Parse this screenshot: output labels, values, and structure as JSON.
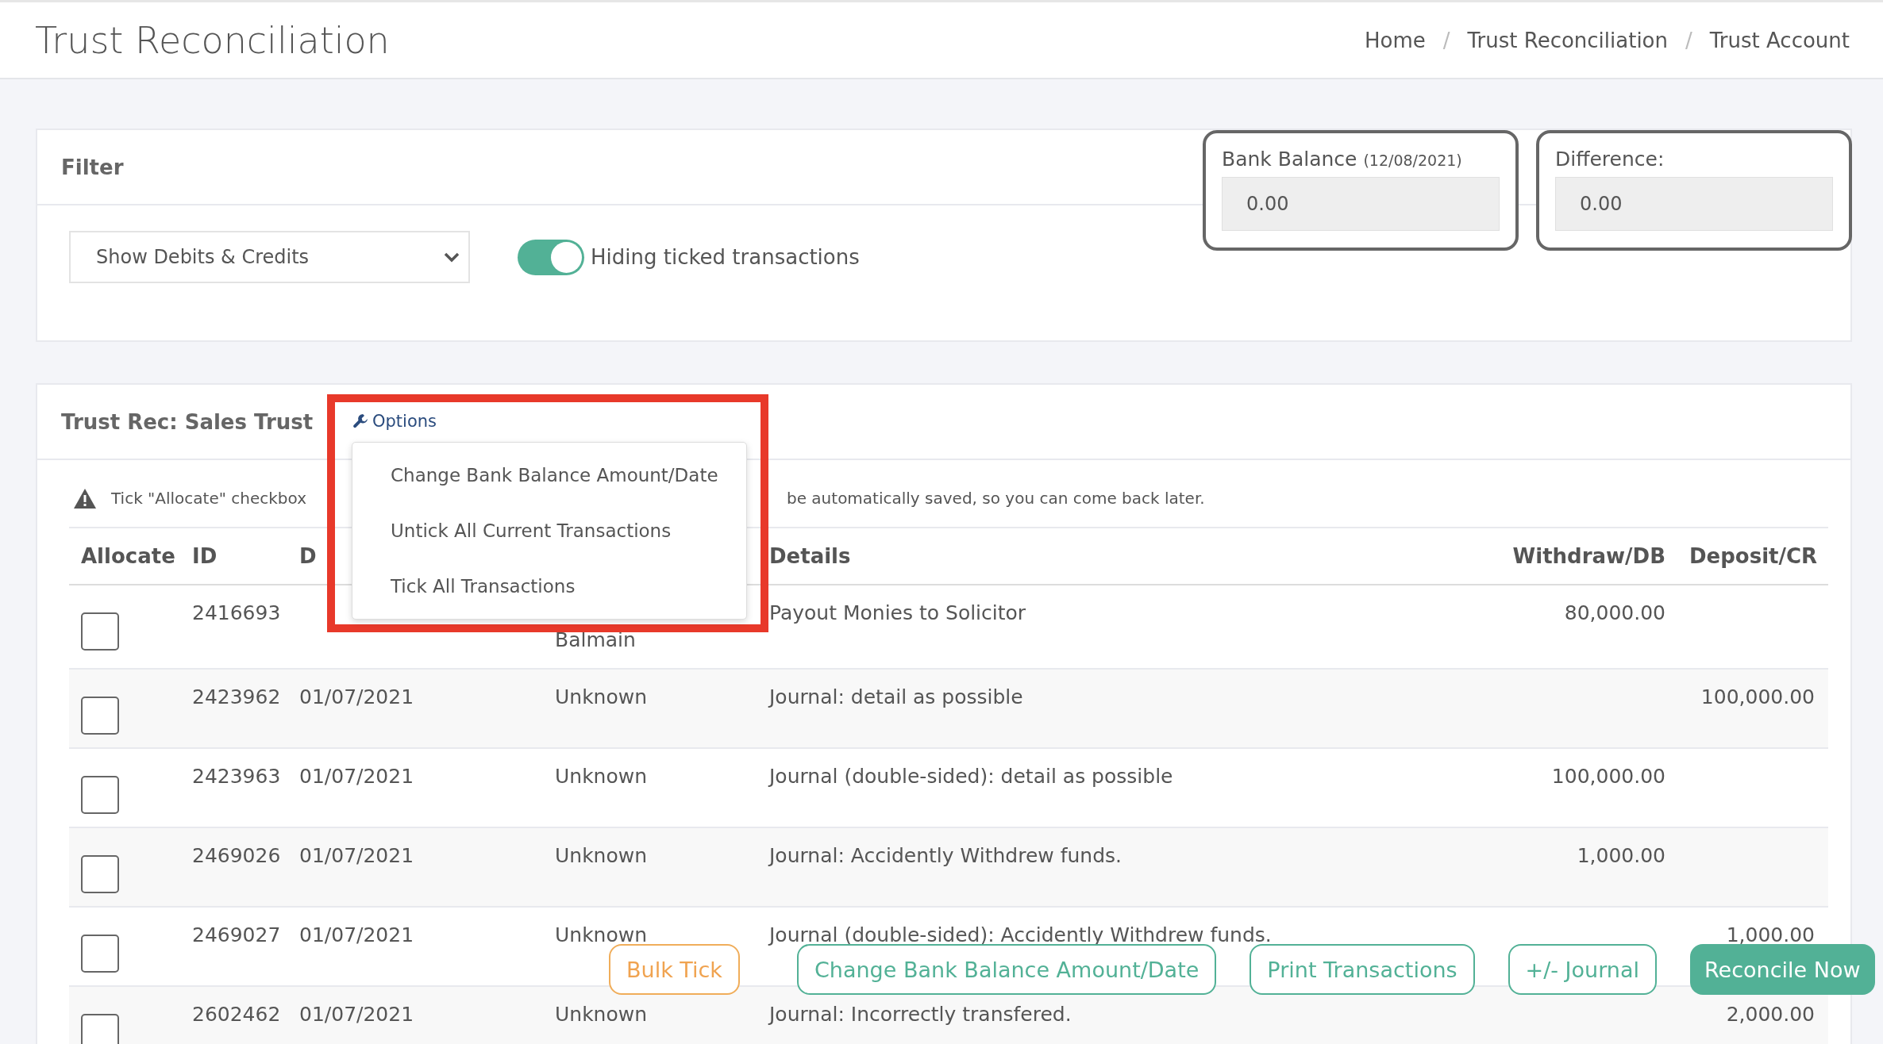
{
  "page_title": "Trust Reconciliation",
  "breadcrumb": [
    "Home",
    "Trust Reconciliation",
    "Trust Account"
  ],
  "breadcrumb_separator": "/",
  "filter": {
    "title": "Filter",
    "select_value": "Show Debits & Credits",
    "toggle": {
      "on": true,
      "label": "Hiding ticked transactions"
    }
  },
  "bank_balance": {
    "label": "Bank Balance",
    "date": "(12/08/2021)",
    "value": "0.00"
  },
  "difference": {
    "label": "Difference:",
    "value": "0.00"
  },
  "trust_rec": {
    "title": "Trust Rec: Sales Trust",
    "options_label": "Options",
    "options_menu": [
      "Change Bank Balance Amount/Date",
      "Untick All Current Transactions",
      "Tick All Transactions"
    ],
    "notice_start": "Tick \"Allocate\" checkbox",
    "notice_end": "be automatically saved, so you can come back later."
  },
  "table": {
    "columns": [
      "Allocate",
      "ID",
      "D",
      "Details",
      "Withdraw/DB",
      "Deposit/CR"
    ],
    "rows": [
      {
        "allocate": false,
        "id": "2416693",
        "property": "Balmain",
        "details": "Payout Monies to Solicitor",
        "withdraw": "80,000.00"
      },
      {
        "allocate": false,
        "id": "2423962",
        "date": "01/07/2021",
        "property": "Unknown",
        "details": "Journal: detail as possible",
        "deposit": "100,000.00"
      },
      {
        "allocate": false,
        "id": "2423963",
        "date": "01/07/2021",
        "property": "Unknown",
        "details": "Journal (double-sided): detail as possible",
        "withdraw": "100,000.00"
      },
      {
        "allocate": false,
        "id": "2469026",
        "date": "01/07/2021",
        "property": "Unknown",
        "details": "Journal: Accidently Withdrew funds.",
        "withdraw": "1,000.00"
      },
      {
        "allocate": false,
        "id": "2469027",
        "date": "01/07/2021",
        "property": "Unknown",
        "details": "Journal (double-sided): Accidently Withdrew funds.",
        "deposit": "1,000.00"
      },
      {
        "allocate": false,
        "id": "2602462",
        "date": "01/07/2021",
        "property": "Unknown",
        "details": "Journal: Incorrectly transfered.",
        "deposit": "2,000.00"
      }
    ]
  },
  "actions": [
    {
      "label": "Bulk Tick",
      "kind": "warning"
    },
    {
      "label": "Change Bank Balance Amount/Date",
      "kind": "outline"
    },
    {
      "label": "Print Transactions",
      "kind": "outline"
    },
    {
      "label": "+/- Journal",
      "kind": "outline"
    },
    {
      "label": "Reconcile Now",
      "kind": "primary"
    }
  ]
}
